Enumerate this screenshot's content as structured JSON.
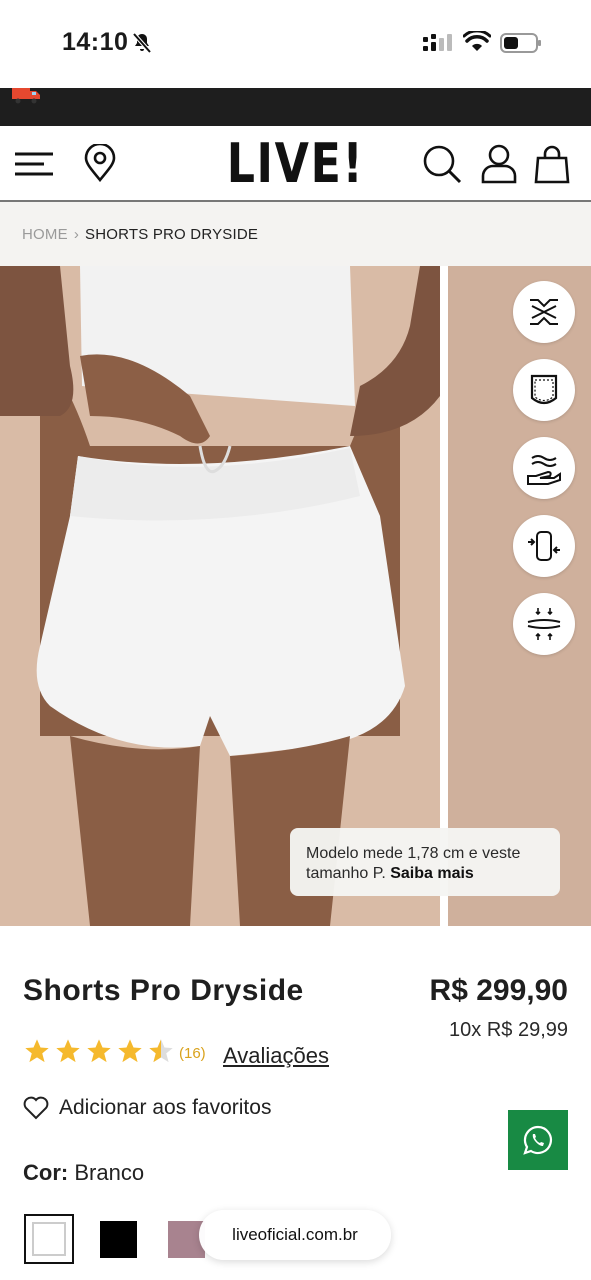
{
  "status_bar": {
    "time": "14:10"
  },
  "header": {
    "logo": "LIVE!",
    "menu_icon": "hamburger-icon",
    "location_icon": "location-pin-icon",
    "search_icon": "search-icon",
    "account_icon": "user-icon",
    "bag_icon": "shopping-bag-icon"
  },
  "breadcrumb": {
    "home": "HOME",
    "separator": "›",
    "current": "SHORTS PRO DRYSIDE"
  },
  "gallery": {
    "model_note_text": "Modelo mede 1,78 cm e veste tamanho P.",
    "model_note_link": "Saiba mais",
    "feature_icons": [
      "stretch-fabric-icon",
      "pocket-icon",
      "soft-touch-icon",
      "compression-icon",
      "breathable-icon"
    ]
  },
  "product": {
    "title": "Shorts Pro Dryside",
    "price": "R$ 299,90",
    "installments": "10x R$ 29,99",
    "rating": 4.5,
    "review_count": "(16)",
    "reviews_link": "Avaliações",
    "favorite_label": "Adicionar aos favoritos",
    "color_label": "Cor:",
    "color_value": "Branco",
    "swatches": [
      {
        "name": "Branco",
        "color": "#ffffff"
      },
      {
        "name": "Preto",
        "color": "#000000"
      },
      {
        "name": "Malva",
        "color": "#a8838f"
      }
    ]
  },
  "browser": {
    "url": "liveoficial.com.br"
  },
  "colors": {
    "promo_bar": "#1e1e1e",
    "star": "#f5b92d",
    "whatsapp": "#188a44"
  }
}
